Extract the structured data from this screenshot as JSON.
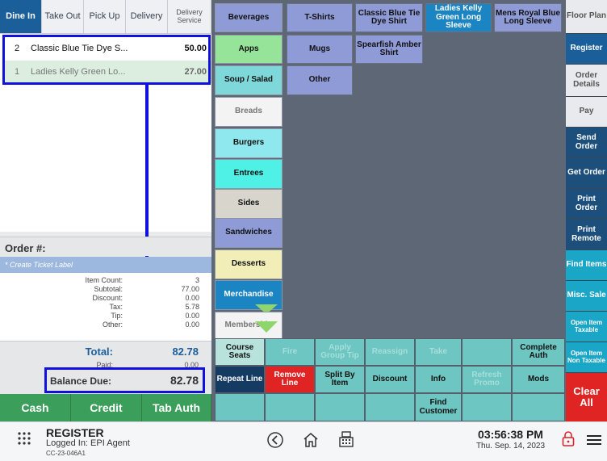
{
  "order_tabs": {
    "dine_in": "Dine In",
    "take_out": "Take Out",
    "pick_up": "Pick Up",
    "delivery": "Delivery",
    "delivery_service": "Delivery Service"
  },
  "order_lines": [
    {
      "qty": "2",
      "name": "Classic Blue Tie Dye S...",
      "price": "50.00"
    },
    {
      "qty": "1",
      "name": "Ladies Kelly Green Lo...",
      "price": "27.00"
    }
  ],
  "order": {
    "number_label": "Order #:",
    "ticket_label_link": "* Create Ticket Label"
  },
  "summary": {
    "rows": [
      {
        "label": "Item Count:",
        "value": "3"
      },
      {
        "label": "Subtotal:",
        "value": "77.00"
      },
      {
        "label": "Discount:",
        "value": "0.00"
      },
      {
        "label": "Tax:",
        "value": "5.78"
      },
      {
        "label": "Tip:",
        "value": "0.00"
      },
      {
        "label": "Other:",
        "value": "0.00"
      }
    ],
    "total_label": "Total:",
    "total_value": "82.78",
    "paid_label": "Paid:",
    "paid_value": "0.00",
    "balance_label": "Balance Due:",
    "balance_value": "82.78"
  },
  "payment": {
    "cash": "Cash",
    "credit": "Credit",
    "tab_auth": "Tab Auth"
  },
  "categories": [
    "Beverages",
    "Apps",
    "Soup / Salad",
    "Breads",
    "Burgers",
    "Entrees",
    "Sides",
    "Sandwiches",
    "Desserts",
    "Merchandise",
    "Membership"
  ],
  "category_colors": [
    "#8f9bd6",
    "#96e39a",
    "#7ed7d9",
    "#f3f3f3",
    "#8ee8ee",
    "#4ff0e6",
    "#d8d5cc",
    "#8f9bd6",
    "#f1eeb8",
    "#1b84c2",
    "#f3f3f3"
  ],
  "items": {
    "tshirts": "T-Shirts",
    "classic_blue": "Classic Blue Tie Dye Shirt",
    "ladies_kelly": "Ladies Kelly Green Long Sleeve",
    "mens_royal": "Mens Royal Blue Long Sleeve",
    "mugs": "Mugs",
    "spearfish": "Spearfish Amber Shirt",
    "other": "Other"
  },
  "actions": {
    "course_seats": "Course Seats",
    "fire": "Fire",
    "apply_group_tip": "Apply Group Tip",
    "reassign": "Reassign",
    "take": "Take",
    "complete_auth": "Complete Auth",
    "repeat_line": "Repeat Line",
    "remove_line": "Remove Line",
    "split_by_item": "Split By Item",
    "discount": "Discount",
    "info": "Info",
    "refresh_promo": "Refresh Promo",
    "mods": "Mods",
    "find_customer": "Find Customer"
  },
  "sidebar": [
    "Floor Plan",
    "Register",
    "Order Details",
    "Pay",
    "Send Order",
    "Get Order",
    "Print Order",
    "Print Remote",
    "Find Items",
    "Misc. Sale",
    "Open Item Taxable",
    "Open Item Non Taxable",
    "Clear All"
  ],
  "footer": {
    "title": "REGISTER",
    "logged_in": "Logged In: EPI Agent",
    "terminal": "CC-23-046A1",
    "time": "03:56:38 PM",
    "date": "Thu. Sep. 14, 2023"
  },
  "colors": {
    "highlight": "#1111dd",
    "accent": "#1a5f9a",
    "clear": "#e02424",
    "pay": "#3b9e5b"
  }
}
